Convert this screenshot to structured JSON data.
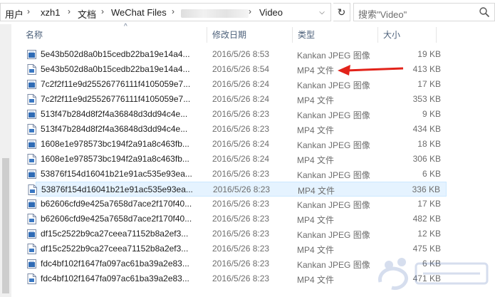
{
  "address": {
    "crumbs": [
      "用户",
      "xzh1",
      "文档",
      "WeChat Files",
      "Video"
    ],
    "refresh_glyph": "↻",
    "dropdown_glyph": "⌵"
  },
  "search": {
    "placeholder": "搜索\"Video\""
  },
  "columns": {
    "name": "名称",
    "date": "修改日期",
    "type": "类型",
    "size": "大小"
  },
  "files": [
    {
      "name": "5e43b502d8a0b15cedb22ba19e14a4...",
      "date": "2016/5/26 8:53",
      "type": "Kankan JPEG 图像",
      "size": "19 KB",
      "kind": "jpeg"
    },
    {
      "name": "5e43b502d8a0b15cedb22ba19e14a4...",
      "date": "2016/5/26 8:54",
      "type": "MP4 文件",
      "size": "413 KB",
      "kind": "mp4"
    },
    {
      "name": "7c2f2f11e9d25526776111f4105059e7...",
      "date": "2016/5/26 8:24",
      "type": "Kankan JPEG 图像",
      "size": "17 KB",
      "kind": "jpeg"
    },
    {
      "name": "7c2f2f11e9d25526776111f4105059e7...",
      "date": "2016/5/26 8:24",
      "type": "MP4 文件",
      "size": "353 KB",
      "kind": "mp4"
    },
    {
      "name": "513f47b284d8f2f4a36848d3dd94c4e...",
      "date": "2016/5/26 8:23",
      "type": "Kankan JPEG 图像",
      "size": "9 KB",
      "kind": "jpeg"
    },
    {
      "name": "513f47b284d8f2f4a36848d3dd94c4e...",
      "date": "2016/5/26 8:23",
      "type": "MP4 文件",
      "size": "434 KB",
      "kind": "mp4"
    },
    {
      "name": "1608e1e978573bc194f2a91a8c463fb...",
      "date": "2016/5/26 8:24",
      "type": "Kankan JPEG 图像",
      "size": "18 KB",
      "kind": "jpeg"
    },
    {
      "name": "1608e1e978573bc194f2a91a8c463fb...",
      "date": "2016/5/26 8:24",
      "type": "MP4 文件",
      "size": "306 KB",
      "kind": "mp4"
    },
    {
      "name": "53876f154d16041b21e91ac535e93ea...",
      "date": "2016/5/26 8:23",
      "type": "Kankan JPEG 图像",
      "size": "6 KB",
      "kind": "jpeg"
    },
    {
      "name": "53876f154d16041b21e91ac535e93ea...",
      "date": "2016/5/26 8:23",
      "type": "MP4 文件",
      "size": "336 KB",
      "kind": "mp4",
      "selected": true
    },
    {
      "name": "b62606cfd9e425a7658d7ace2f170f40...",
      "date": "2016/5/26 8:23",
      "type": "Kankan JPEG 图像",
      "size": "17 KB",
      "kind": "jpeg"
    },
    {
      "name": "b62606cfd9e425a7658d7ace2f170f40...",
      "date": "2016/5/26 8:23",
      "type": "MP4 文件",
      "size": "482 KB",
      "kind": "mp4"
    },
    {
      "name": "df15c2522b9ca27ceea71152b8a2ef3...",
      "date": "2016/5/26 8:23",
      "type": "Kankan JPEG 图像",
      "size": "12 KB",
      "kind": "jpeg"
    },
    {
      "name": "df15c2522b9ca27ceea71152b8a2ef3...",
      "date": "2016/5/26 8:23",
      "type": "MP4 文件",
      "size": "475 KB",
      "kind": "mp4"
    },
    {
      "name": "fdc4bf102f1647fa097ac61ba39a2e83...",
      "date": "2016/5/26 8:23",
      "type": "Kankan JPEG 图像",
      "size": "6 KB",
      "kind": "jpeg"
    },
    {
      "name": "fdc4bf102f1647fa097ac61ba39a2e83...",
      "date": "2016/5/26 8:23",
      "type": "MP4 文件",
      "size": "471 KB",
      "kind": "mp4"
    }
  ],
  "colors": {
    "annotation_arrow": "#e2231a",
    "selected_row": "#e5f3ff",
    "header_text": "#4c607a"
  }
}
